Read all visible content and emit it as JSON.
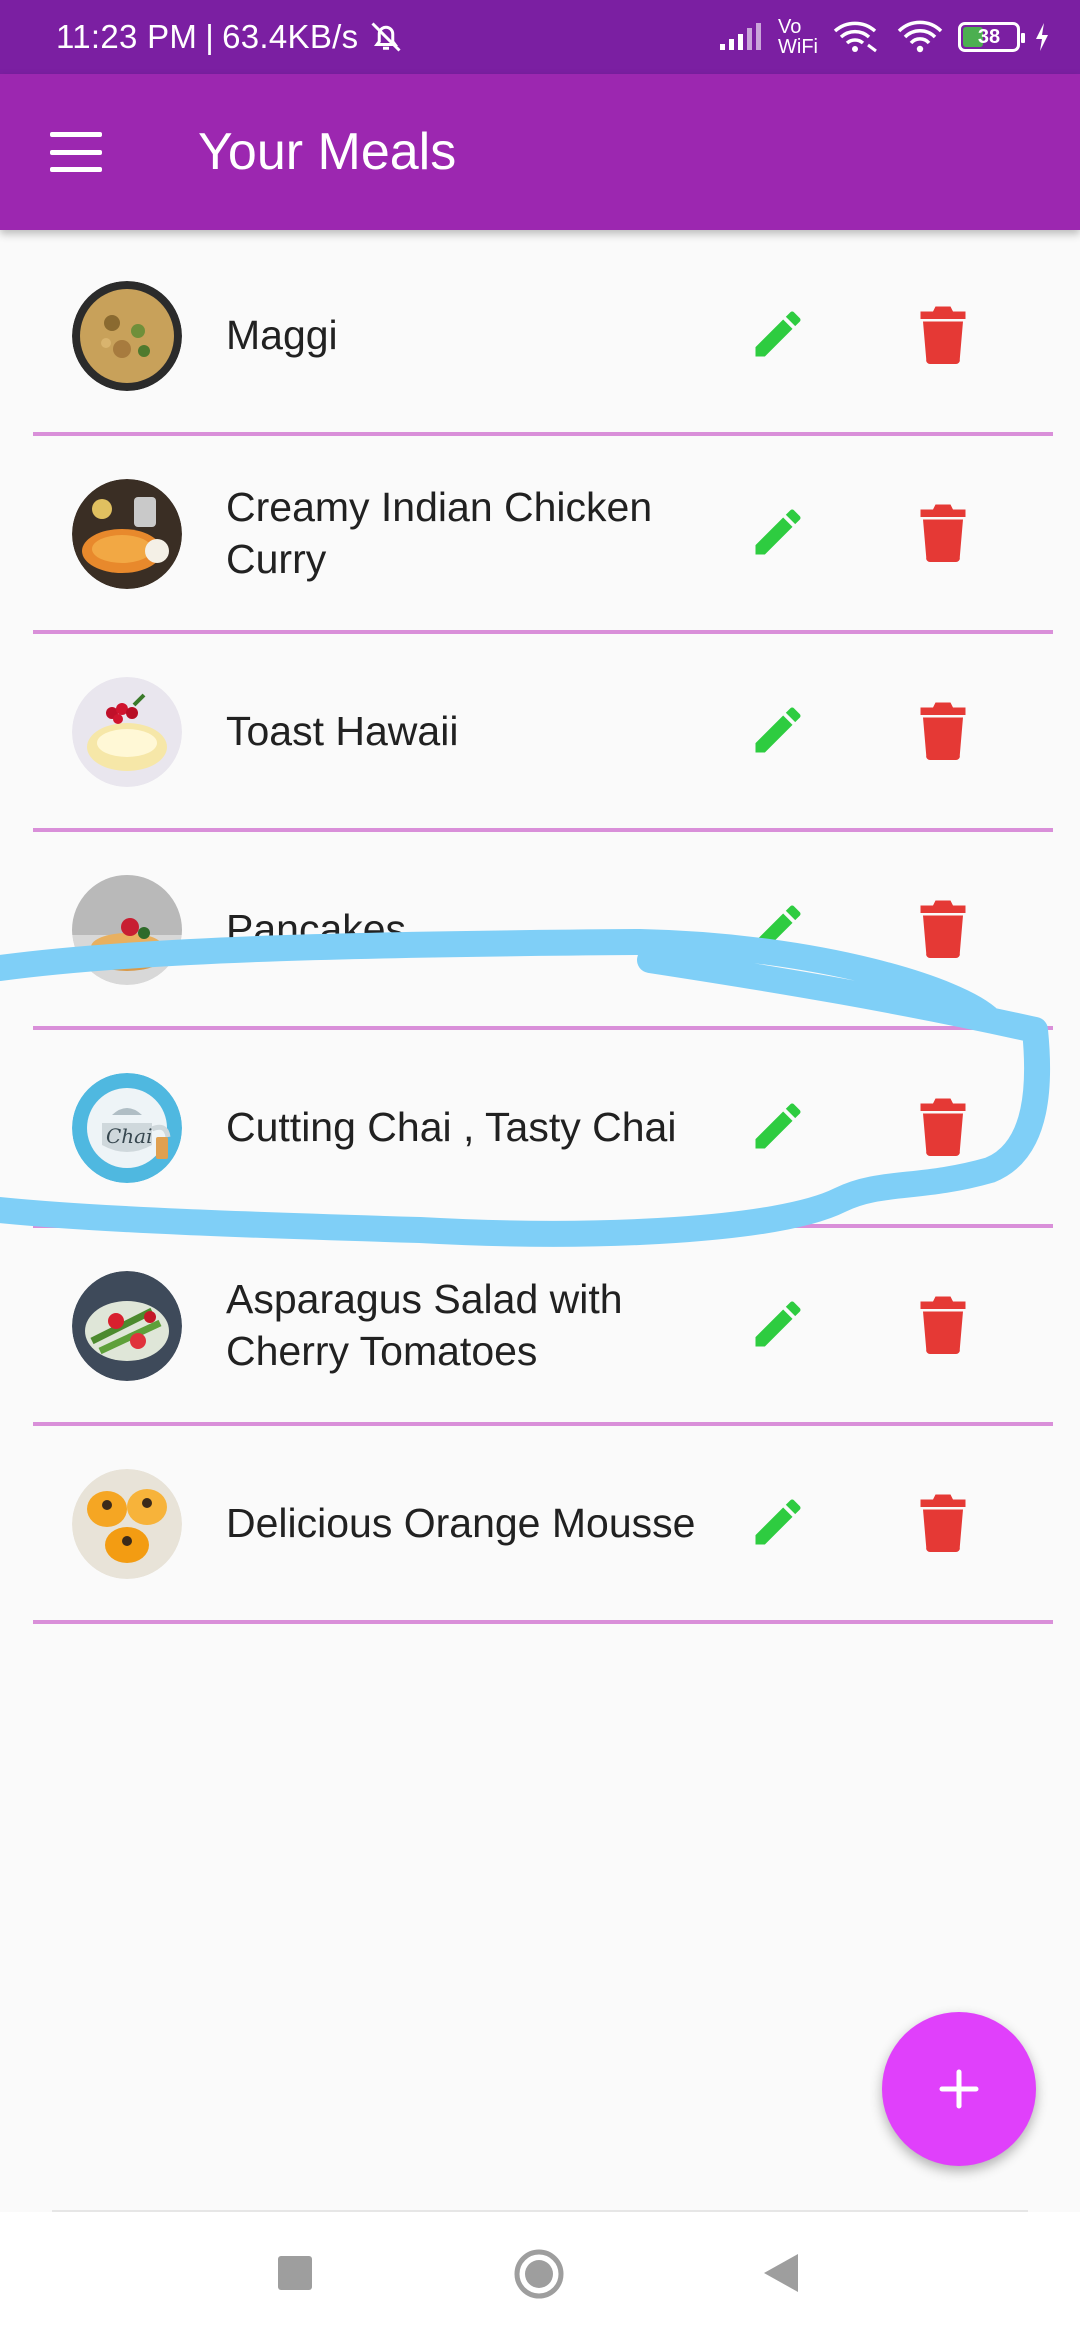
{
  "status_bar": {
    "time": "11:23 PM",
    "speed": "63.4KB/s",
    "separator": "|",
    "vowifi_top": "Vo",
    "vowifi_bottom": "WiFi",
    "battery": "38"
  },
  "app_bar": {
    "title": "Your Meals"
  },
  "meals": [
    {
      "name": "Maggi",
      "image": "maggi-noodles-photo"
    },
    {
      "name": "Creamy Indian Chicken Curry",
      "image": "chicken-curry-photo"
    },
    {
      "name": "Toast Hawaii",
      "image": "toast-hawaii-photo"
    },
    {
      "name": "Pancakes",
      "image": "pancakes-photo"
    },
    {
      "name": "Cutting Chai , Tasty Chai",
      "image": "chai-kettle-photo",
      "image_text": "Chai"
    },
    {
      "name": "Asparagus Salad with Cherry Tomatoes",
      "image": "asparagus-salad-photo"
    },
    {
      "name": "Delicious Orange Mousse",
      "image": "orange-mousse-photo"
    }
  ],
  "fab": {
    "symbol": "+",
    "icon": "add-icon"
  },
  "colors": {
    "status_bar": "#7b1fa2",
    "app_bar": "#9c27b0",
    "divider": "#d98fd9",
    "edit": "#2ecc40",
    "delete": "#e53935",
    "fab": "#e040fb",
    "annotation_stroke": "#7fcff7"
  },
  "nav_bar": {
    "icons": [
      "recent-apps-icon",
      "home-icon",
      "back-icon"
    ]
  }
}
